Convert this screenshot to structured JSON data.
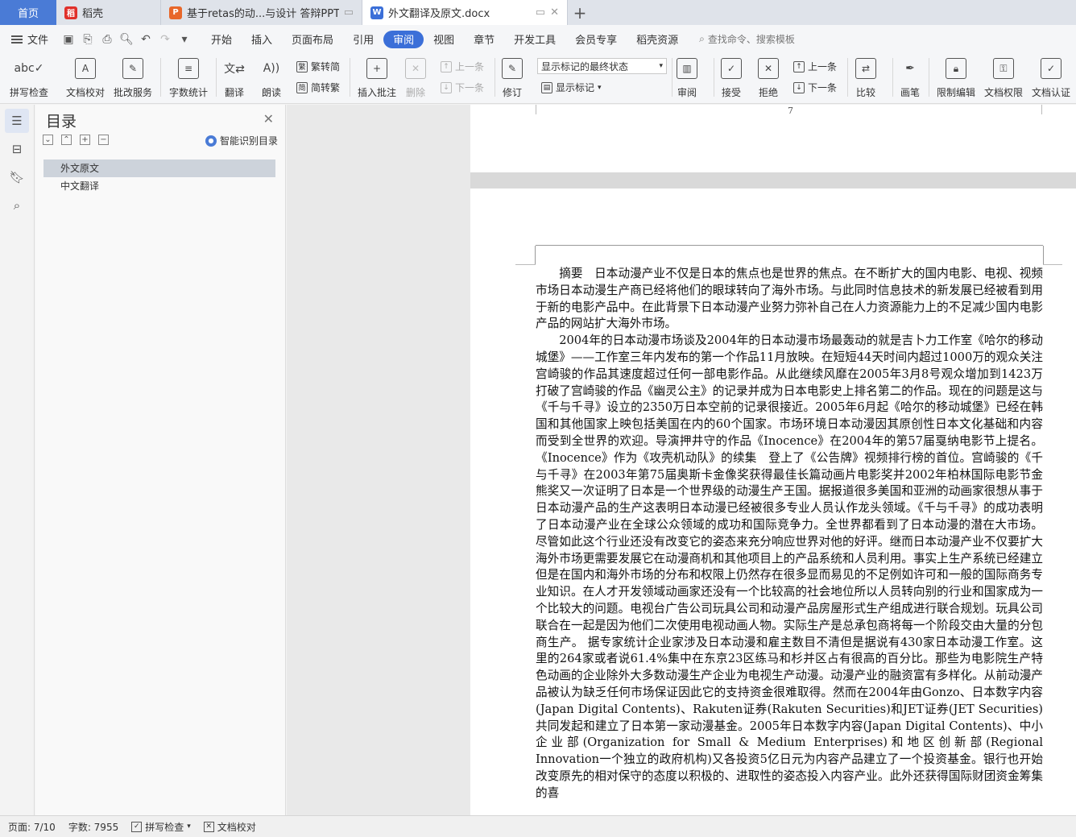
{
  "tabs": {
    "home": "首页",
    "items": [
      {
        "label": "稻壳",
        "icon_color": "#e0302a",
        "icon": "daoke-icon"
      },
      {
        "label": "基于retas的动...与设计 答辩PPT",
        "icon_color": "#e8672a",
        "icon": "ppt-icon"
      },
      {
        "label": "外文翻译及原文.docx",
        "icon_color": "#3b6fd8",
        "icon": "word-icon"
      }
    ],
    "add": "+"
  },
  "menu": {
    "file": "文件",
    "items": [
      "开始",
      "插入",
      "页面布局",
      "引用",
      "审阅",
      "视图",
      "章节",
      "开发工具",
      "会员专享",
      "稻壳资源"
    ],
    "active": "审阅",
    "search_placeholder": "查找命令、搜索模板"
  },
  "ribbon": {
    "spellcheck": "拼写检查",
    "doc_proof": "文档校对",
    "correction_service": "批改服务",
    "word_count": "字数统计",
    "translate": "翻译",
    "read_aloud": "朗读",
    "trad_to_simp": "繁转简",
    "simp_to_trad": "简转繁",
    "insert_comment": "插入批注",
    "delete": "删除",
    "prev_comment": "上一条",
    "next_comment": "下一条",
    "revise": "修订",
    "markup_state": "显示标记的最终状态",
    "show_markup": "显示标记",
    "review": "审阅",
    "accept": "接受",
    "reject": "拒绝",
    "prev_change": "上一条",
    "next_change": "下一条",
    "compare": "比较",
    "pen": "画笔",
    "restrict_edit": "限制编辑",
    "doc_permission": "文档权限",
    "doc_certify": "文档认证"
  },
  "toc": {
    "title": "目录",
    "smart": "智能识别目录",
    "items": [
      "外文原文",
      "中文翻译"
    ]
  },
  "document": {
    "prev_page_number": "7",
    "paragraphs": [
      "摘要　日本动漫产业不仅是日本的焦点也是世界的焦点。在不断扩大的国内电影、电视、视频市场日本动漫生产商已经将他们的眼球转向了海外市场。与此同时信息技术的新发展已经被看到用于新的电影产品中。在此背景下日本动漫产业努力弥补自己在人力资源能力上的不足减少国内电影产品的网站扩大海外市场。",
      "2004年的日本动漫市场谈及2004年的日本动漫市场最轰动的就是吉卜力工作室《哈尔的移动城堡》——工作室三年内发布的第一个作品11月放映。在短短44天时间内超过1000万的观众关注宫崎骏的作品其速度超过任何一部电影作品。从此继续风靡在2005年3月8号观众增加到1423万打破了宫崎骏的作品《幽灵公主》的记录并成为日本电影史上排名第二的作品。现在的问题是这与《千与千寻》设立的2350万日本空前的记录很接近。2005年6月起《哈尔的移动城堡》已经在韩国和其他国家上映包括美国在内的60个国家。市场环境日本动漫因其原创性日本文化基础和内容而受到全世界的欢迎。导演押井守的作品《Inocence》在2004年的第57届戛纳电影节上提名。《Inocence》作为《攻壳机动队》的续集　登上了《公告牌》视频排行榜的首位。宫崎骏的《千与千寻》在2003年第75届奥斯卡金像奖获得最佳长篇动画片电影奖并2002年柏林国际电影节金熊奖又一次证明了日本是一个世界级的动漫生产王国。据报道很多美国和亚洲的动画家很想从事于日本动漫产品的生产这表明日本动漫已经被很多专业人员认作龙头领域。《千与千寻》的成功表明了日本动漫产业在全球公众领域的成功和国际竞争力。全世界都看到了日本动漫的潜在大市场。 尽管如此这个行业还没有改变它的姿态来充分响应世界对他的好评。继而日本动漫产业不仅要扩大海外市场更需要发展它在动漫商机和其他项目上的产品系统和人员利用。事实上生产系统已经建立但是在国内和海外市场的分布和权限上仍然存在很多显而易见的不足例如许可和一般的国际商务专业知识。在人才开发领域动画家还没有一个比较高的社会地位所以人员转向别的行业和国家成为一个比较大的问题。电视台广告公司玩具公司和动漫产品房屋形式生产组成进行联合规划。玩具公司联合在一起是因为他们二次使用电视动画人物。实际生产是总承包商将每一个阶段交由大量的分包商生产。 据专家统计企业家涉及日本动漫和雇主数目不清但是据说有430家日本动漫工作室。这里的264家或者说61.4%集中在东京23区练马和杉并区占有很高的百分比。那些为电影院生产特色动画的企业除外大多数动漫生产企业为电视生产动漫。动漫产业的融资富有多样化。从前动漫产品被认为缺乏任何市场保证因此它的支持资金很难取得。然而在2004年由Gonzo、日本数字内容(Japan Digital Contents)、Rakuten证券(Rakuten Securities)和JET证券(JET Securities)共同发起和建立了日本第一家动漫基金。2005年日本数字内容(Japan Digital Contents)、中小企业部(Organization for Small & Medium Enterprises)和地区创新部(Regional Innovation一个独立的政府机构)又各投资5亿日元为内容产品建立了一个投资基金。银行也开始改变原先的相对保守的态度以积极的、进取性的姿态投入内容产业。此外还获得国际财团资金筹集的喜"
    ]
  },
  "status": {
    "page": "页面: 7/10",
    "words": "字数: 7955",
    "spellcheck": "拼写检查",
    "doc_proof": "文档校对"
  },
  "colors": {
    "accent": "#3b6fd8",
    "home_tab": "#4a7bd6"
  }
}
